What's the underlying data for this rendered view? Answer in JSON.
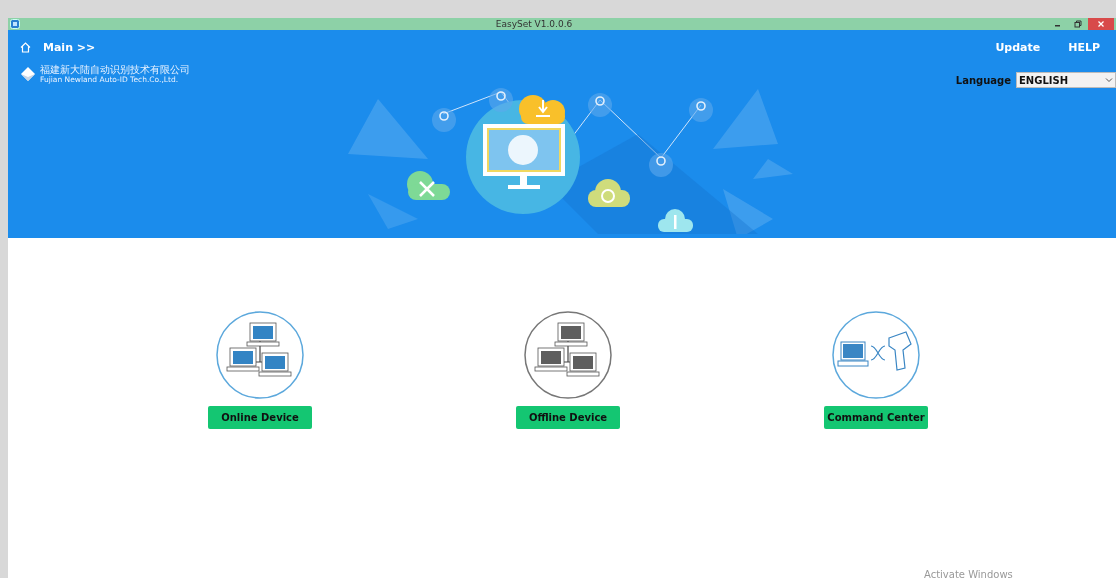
{
  "window": {
    "title": "EasySet V1.0.0.6"
  },
  "breadcrumb": "Main >>",
  "logo": {
    "name_cn": "福建新大陆自动识别技术有限公司",
    "name_en": "Fujian Newland Auto-ID Tech.Co.,Ltd."
  },
  "top_links": [
    "Update",
    "HELP"
  ],
  "language": {
    "label": "Language",
    "value": "ENGLISH"
  },
  "cards": [
    {
      "kind": "online",
      "label": "Online Device"
    },
    {
      "kind": "offline",
      "label": "Offline Device"
    },
    {
      "kind": "command",
      "label": "Command Center"
    }
  ],
  "watermark_notice": "Activate Windows"
}
